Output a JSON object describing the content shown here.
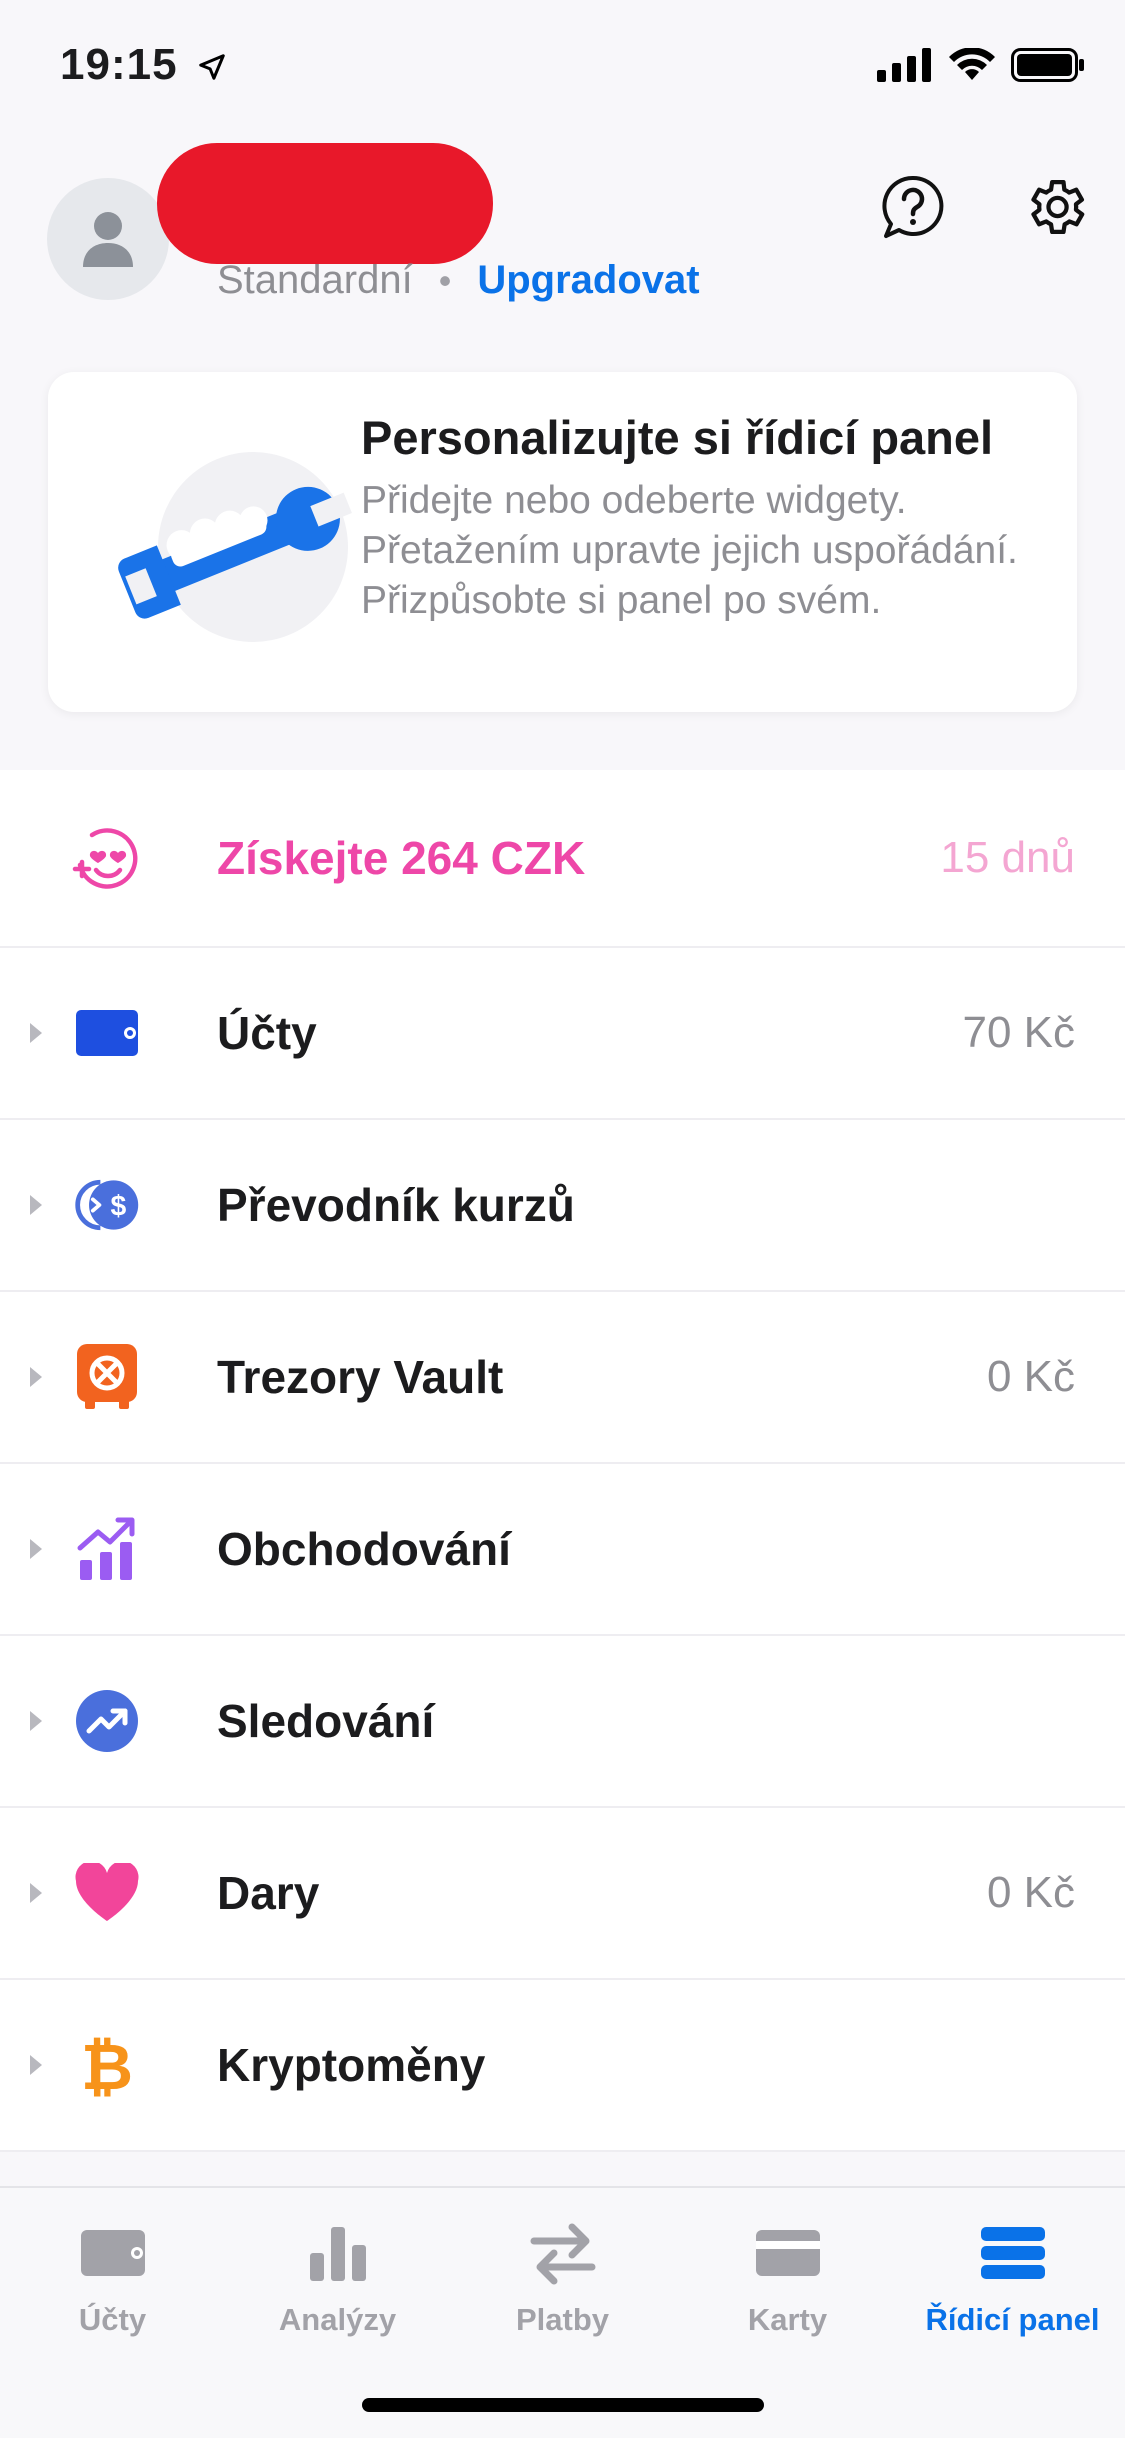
{
  "status_bar": {
    "time": "19:15"
  },
  "header": {
    "plan": "Standardní",
    "separator": "•",
    "upgrade_label": "Upgradovat"
  },
  "card": {
    "title": "Personalizujte si řídicí panel",
    "text": "Přidejte nebo odeberte widgety. Přetažením upravte jejich uspořádání. Přizpůsobte si panel po svém."
  },
  "promo": {
    "label": "Získejte 264 CZK",
    "value": "15 dnů"
  },
  "rows": [
    {
      "label": "Účty",
      "value": "70 Kč",
      "icon": "wallet-icon"
    },
    {
      "label": "Převodník kurzů",
      "value": "",
      "icon": "currency-exchange-icon"
    },
    {
      "label": "Trezory Vault",
      "value": "0 Kč",
      "icon": "vault-icon"
    },
    {
      "label": "Obchodování",
      "value": "",
      "icon": "trading-chart-icon"
    },
    {
      "label": "Sledování",
      "value": "",
      "icon": "trend-up-icon"
    },
    {
      "label": "Dary",
      "value": "0 Kč",
      "icon": "heart-icon"
    },
    {
      "label": "Kryptoměny",
      "value": "",
      "icon": "bitcoin-icon"
    }
  ],
  "tabs": [
    {
      "label": "Účty",
      "icon": "wallet-icon",
      "active": false
    },
    {
      "label": "Analýzy",
      "icon": "bar-chart-icon",
      "active": false
    },
    {
      "label": "Platby",
      "icon": "transfer-arrows-icon",
      "active": false
    },
    {
      "label": "Karty",
      "icon": "card-icon",
      "active": false
    },
    {
      "label": "Řídicí panel",
      "icon": "dashboard-icon",
      "active": true
    }
  ],
  "colors": {
    "accent": "#0a72e8",
    "promo": "#ee47a8",
    "redaction": "#e8182a"
  }
}
